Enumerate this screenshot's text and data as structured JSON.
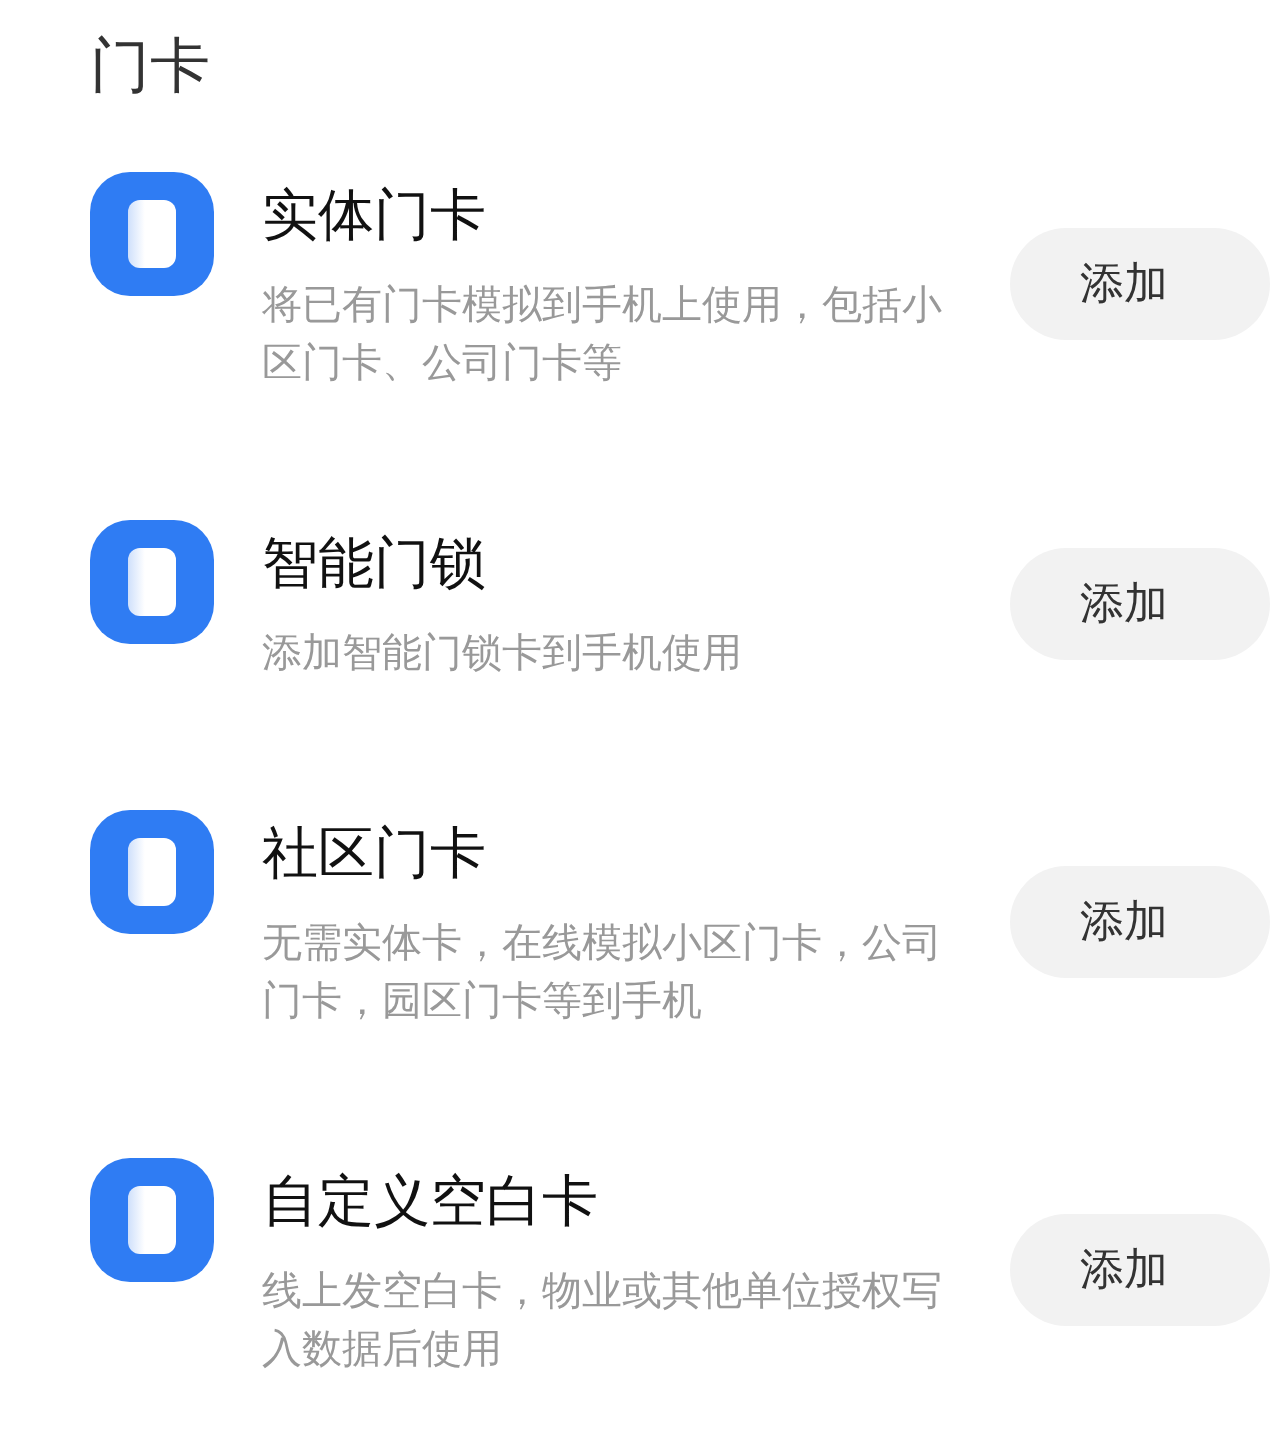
{
  "section_title": "门卡",
  "items": [
    {
      "title": "实体门卡",
      "description": "将已有门卡模拟到手机上使用，包括小区门卡、公司门卡等",
      "button": "添加"
    },
    {
      "title": "智能门锁",
      "description": "添加智能门锁卡到手机使用",
      "button": "添加"
    },
    {
      "title": "社区门卡",
      "description": "无需实体卡，在线模拟小区门卡，公司门卡，园区门卡等到手机",
      "button": "添加"
    },
    {
      "title": "自定义空白卡",
      "description": "线上发空白卡，物业或其他单位授权写入数据后使用",
      "button": "添加"
    }
  ]
}
